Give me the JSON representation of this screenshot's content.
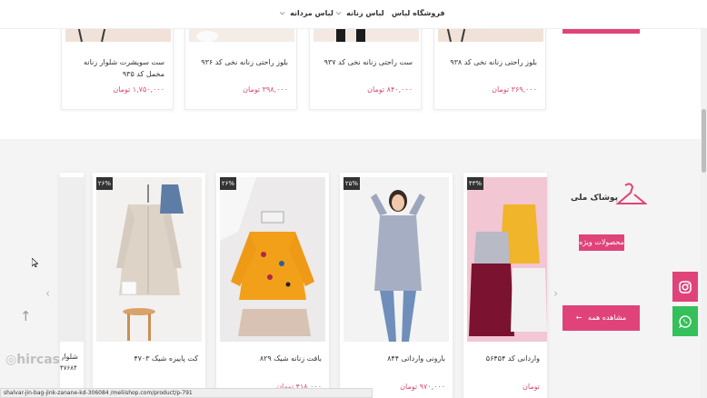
{
  "nav": {
    "items": [
      {
        "label": "فروشگاه لباس",
        "dropdown": false
      },
      {
        "label": "لباس زنانه",
        "dropdown": true
      },
      {
        "label": "لباس مردانه",
        "dropdown": true
      }
    ]
  },
  "top_products": [
    {
      "name": "بلوز راحتی زنانه نخی کد ۹۳۸",
      "price": "۳۶۹,۰۰۰ تومان"
    },
    {
      "name": "ست راحتی زنانه نخی کد ۹۳۷",
      "price": "۸۴۰,۰۰۰ تومان"
    },
    {
      "name": "بلوز راحتی زنانه نخی کد ۹۳۶",
      "price": "۳۹۸,۰۰۰ تومان"
    },
    {
      "name": "ست سویشرت شلوار زنانه مخمل کد ۹۳۵",
      "price": "۱,۷۵۰,۰۰۰ تومان"
    }
  ],
  "featured_products": [
    {
      "badge": "۴۳%",
      "name": "واردانی کد ۵۶۴۵۴",
      "price": "تومان"
    },
    {
      "badge": "۲۵%",
      "name": "بارونی وارداتی ۸۴۴",
      "price": "۹۷۰,۰۰۰ تومان"
    },
    {
      "badge": "۲۶%",
      "name": "بافت زنانه شیک ۸۲۹",
      "price": "۴۱۸,۰۰۰ تومان"
    },
    {
      "badge": "۲۶%",
      "name": "کت پاییزه شیک ۴۷۰۳",
      "price": ""
    }
  ],
  "partial_card": {
    "name": "شلوار",
    "number": "۴۷۶۸۴"
  },
  "sidebar": {
    "logo_text": "پوشاک ملی",
    "featured_label": "محصولات ویژه",
    "view_all_label": "مشاهده همه"
  },
  "watermark": "hircas",
  "status_url": "shalvar-jin-bag-jink-zanane-kd-306084 /meliishop.com/product/p-791",
  "social": {
    "instagram_color": "#e0437a",
    "whatsapp_color": "#34c05a"
  },
  "colors": {
    "accent": "#e0437a",
    "price": "#d84a6d"
  }
}
